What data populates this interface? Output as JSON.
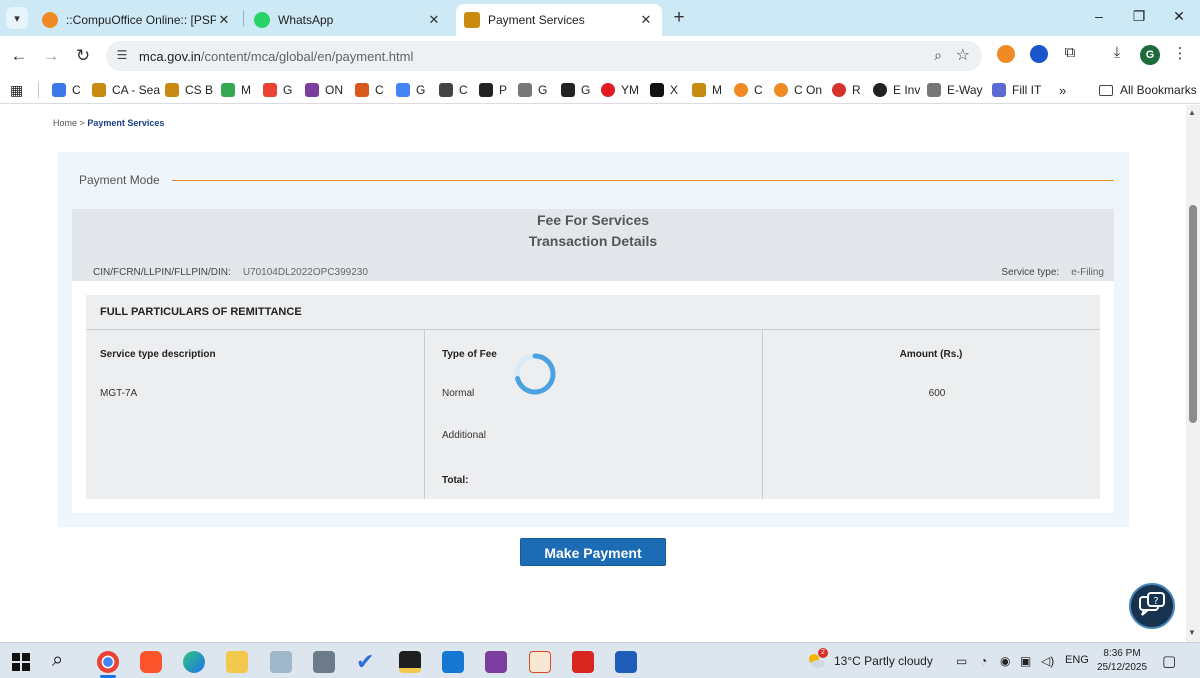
{
  "browser": {
    "tabs": [
      {
        "title": "::CompuOffice Online:: [PSPL Ph",
        "active": false
      },
      {
        "title": "WhatsApp",
        "active": false
      },
      {
        "title": "Payment Services",
        "active": true
      }
    ],
    "tab_menu_icon": "chevron-down-icon",
    "new_tab_symbol": "+",
    "window_controls": [
      "–",
      "❐",
      "✕"
    ],
    "url_host": "mca.gov.in",
    "url_path": "/content/mca/global/en/payment.html",
    "profile_initial": "G"
  },
  "bookmarks": [
    {
      "label": "C",
      "color": "#3b78e7"
    },
    {
      "label": "CA - Sea",
      "color": "#c98a12"
    },
    {
      "label": "CS B",
      "color": "#c98a12"
    },
    {
      "label": "M",
      "color": "#34a853"
    },
    {
      "label": "G",
      "color": "#ea4335"
    },
    {
      "label": "ON",
      "color": "#7b3fa0"
    },
    {
      "label": "C",
      "color": "#d9581e"
    },
    {
      "label": "G",
      "color": "#4285f4"
    },
    {
      "label": "C",
      "color": "#444444"
    },
    {
      "label": "P",
      "color": "#222222"
    },
    {
      "label": "G",
      "color": "#777777"
    },
    {
      "label": "G",
      "color": "#222222"
    },
    {
      "label": "YM",
      "color": "#e21c24"
    },
    {
      "label": "X",
      "color": "#111111"
    },
    {
      "label": "M",
      "color": "#c98a12"
    },
    {
      "label": "C",
      "color": "#f08a24"
    },
    {
      "label": "C On",
      "color": "#f08a24"
    },
    {
      "label": "R",
      "color": "#d6322a"
    },
    {
      "label": "E Inv",
      "color": "#222222"
    },
    {
      "label": "E-Way",
      "color": "#777777"
    },
    {
      "label": "Fill IT",
      "color": "#5a6ad3"
    }
  ],
  "bookmarks_overflow": "»",
  "all_bookmarks": "All Bookmarks",
  "breadcrumb": {
    "home": "Home",
    "separator": ">",
    "current": "Payment Services"
  },
  "payment_mode_label": "Payment Mode",
  "header": {
    "title1": "Fee For Services",
    "title2": "Transaction Details",
    "cin_label": "CIN/FCRN/LLPIN/FLLPIN/DIN:",
    "cin_value": "U70104DL2022OPC399230",
    "service_type_label": "Service type:",
    "service_type_value": "e-Filing"
  },
  "remittance": {
    "heading": "FULL PARTICULARS OF REMITTANCE",
    "col1_header": "Service type description",
    "col2_header": "Type of Fee",
    "col3_header": "Amount (Rs.)",
    "service_desc": "MGT-7A",
    "fee_normal": "Normal",
    "fee_additional": "Additional",
    "total_label": "Total:",
    "amount_normal": "600"
  },
  "make_payment_label": "Make Payment",
  "taskbar": {
    "weather_badge": "2",
    "weather": "13°C  Partly cloudy",
    "language": "ENG",
    "time": "8:36 PM",
    "date": "25/12/2025"
  },
  "colors": {
    "accent_orange": "#e08a1e",
    "button_blue": "#1b6cb5",
    "panel_bg": "#eef5fb",
    "tab_strip": "#cde9f6"
  }
}
